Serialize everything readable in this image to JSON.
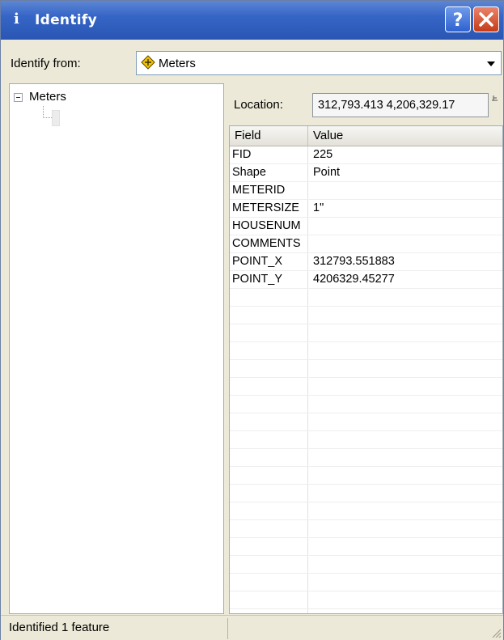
{
  "window": {
    "title": "Identify",
    "title_icon": "i"
  },
  "identify_from": {
    "label": "Identify from:",
    "selected": "Meters"
  },
  "tree": {
    "root_label": "Meters"
  },
  "location": {
    "label": "Location:",
    "value": "312,793.413  4,206,329.17"
  },
  "grid": {
    "columns": [
      "Field",
      "Value"
    ],
    "rows": [
      {
        "field": "FID",
        "value": "225"
      },
      {
        "field": "Shape",
        "value": "Point"
      },
      {
        "field": "METERID",
        "value": ""
      },
      {
        "field": "METERSIZE",
        "value": "1\""
      },
      {
        "field": "HOUSENUM",
        "value": ""
      },
      {
        "field": "COMMENTS",
        "value": ""
      },
      {
        "field": "POINT_X",
        "value": "312793.551883"
      },
      {
        "field": "POINT_Y",
        "value": "4206329.45277"
      }
    ]
  },
  "status": {
    "text": "Identified 1 feature"
  },
  "icons": {
    "title": "info-icon",
    "help": "question-mark-icon",
    "close": "close-x-icon",
    "layer": "layer-diamond-icon",
    "dropdown": "chevron-down-icon",
    "pin": "pin-icon",
    "grip": "resize-grip-icon"
  },
  "colors": {
    "titlebar": "#2a56b3",
    "close_button": "#c53b18",
    "help_button": "#2f61d0",
    "layer_icon": "#f2c200"
  }
}
